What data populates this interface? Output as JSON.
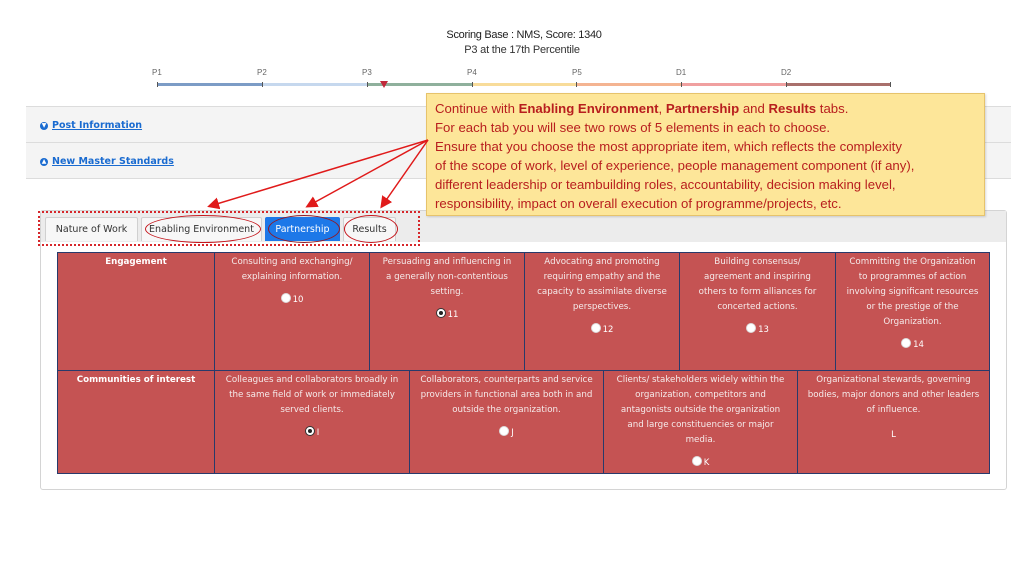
{
  "score": {
    "title": "Scoring Base : NMS, Score: 1340",
    "subtitle": "P3 at the 17th Percentile",
    "marker_percentile": 17,
    "current_level": "P3"
  },
  "scale": {
    "levels": [
      {
        "label": "P1",
        "color": "#7c9cc6"
      },
      {
        "label": "P2",
        "color": "#c6d8ee"
      },
      {
        "label": "P3",
        "color": "#8fb09c"
      },
      {
        "label": "P4",
        "color": "#f8dc9a"
      },
      {
        "label": "P5",
        "color": "#f4b492"
      },
      {
        "label": "D1",
        "color": "#f0a0a0"
      },
      {
        "label": "D2",
        "color": "#a9706c"
      }
    ]
  },
  "accordion": {
    "post_information": "Post Information",
    "new_master_standards": "New Master Standards"
  },
  "tabs": [
    {
      "label": "Nature of Work",
      "active": false,
      "highlighted": false
    },
    {
      "label": "Enabling Environment",
      "active": false,
      "highlighted": true
    },
    {
      "label": "Partnership",
      "active": true,
      "highlighted": true
    },
    {
      "label": "Results",
      "active": false,
      "highlighted": true
    }
  ],
  "callout": {
    "line1_pre": "Continue with ",
    "line1_b1": "Enabling Environment",
    "line1_sep": ", ",
    "line1_b2": "Partnership",
    "line1_mid": " and ",
    "line1_b3": "Results",
    "line1_post": " tabs.",
    "line2": "For each tab you will see two rows of 5 elements in each to choose.",
    "line3": "Ensure that you choose the most appropriate item, which reflects the complexity",
    "line4": "of the scope of work, level of experience, people management component (if any),",
    "line5": "different leadership or teambuilding roles, accountability, decision making level,",
    "line6": "responsibility, impact on overall execution of programme/projects, etc.",
    "accent_color": "#b81e1e",
    "background": "#fde699"
  },
  "rows": [
    {
      "header": "Engagement",
      "options": [
        {
          "text": "Consulting and exchanging/ explaining information.",
          "value": "10",
          "checked": false
        },
        {
          "text": "Persuading and influencing in a generally non-contentious setting.",
          "value": "11",
          "checked": true
        },
        {
          "text": "Advocating and promoting requiring empathy and the capacity to assimilate diverse perspectives.",
          "value": "12",
          "checked": false
        },
        {
          "text": "Building consensus/ agreement and inspiring others to form alliances for concerted actions.",
          "value": "13",
          "checked": false
        },
        {
          "text": "Committing the Organization to programmes of action involving significant resources or the prestige of the Organization.",
          "value": "14",
          "checked": false
        }
      ]
    },
    {
      "header": "Communities of interest",
      "options": [
        {
          "text": "Colleagues and collaborators broadly in the same field of work or immediately served clients.",
          "value": "I",
          "checked": true
        },
        {
          "text": "Collaborators, counterparts and service providers in functional area both in and outside the organization.",
          "value": "J",
          "checked": false
        },
        {
          "text": "Clients/ stakeholders widely within the organization, competitors and antagonists outside the organization and large constituencies or major media.",
          "value": "K",
          "checked": false
        },
        {
          "text": "Organizational stewards, governing bodies, major donors and other leaders of influence.",
          "value": "L",
          "checked": false,
          "no_radio": true
        }
      ]
    }
  ],
  "colors": {
    "cell_bg": "#c55353",
    "cell_border": "#283a6b",
    "active_tab": "#1d78e8",
    "link": "#1a6bd0",
    "annotation_red": "#d6262a"
  }
}
